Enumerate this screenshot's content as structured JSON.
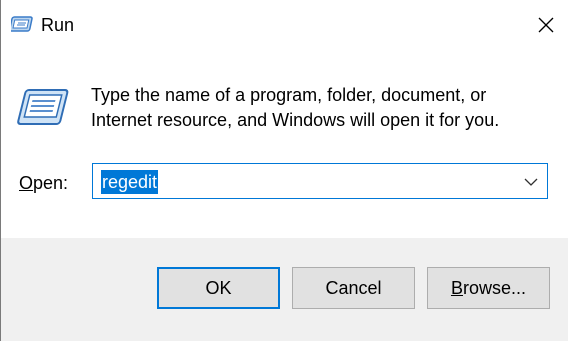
{
  "window": {
    "title": "Run"
  },
  "icons": {
    "title": "run-icon",
    "big": "run-icon",
    "close": "close-icon",
    "dropdown": "chevron-down-icon"
  },
  "description": {
    "line1": "Type the name of a program, folder, document, or",
    "line2": "Internet resource, and Windows will open it for you."
  },
  "open": {
    "label_prefix": "",
    "label_accel": "O",
    "label_rest": "pen:",
    "value": "regedit"
  },
  "buttons": {
    "ok": "OK",
    "cancel": "Cancel",
    "browse_accel": "B",
    "browse_rest": "rowse..."
  },
  "colors": {
    "accent": "#0078d7",
    "footer_bg": "#f0f0f0",
    "button_bg": "#e1e1e1"
  }
}
